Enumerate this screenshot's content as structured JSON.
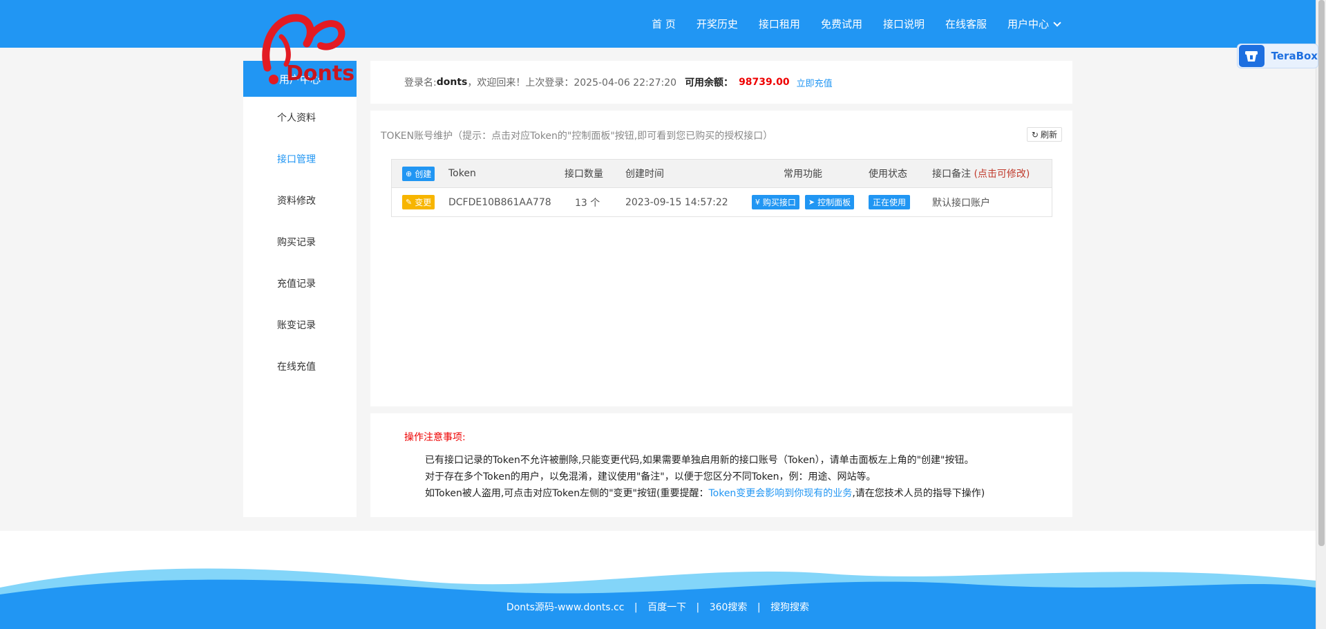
{
  "nav": {
    "items": [
      "首  页",
      "开奖历史",
      "接口租用",
      "免费试用",
      "接口说明",
      "在线客服",
      "用户中心"
    ]
  },
  "logo": {
    "text": "Donts"
  },
  "terabox": {
    "label": "TeraBox"
  },
  "sidebar": {
    "header": "用户中心",
    "items": [
      "个人资料",
      "接口管理",
      "资料修改",
      "购买记录",
      "充值记录",
      "账变记录",
      "在线充值"
    ],
    "active_index": 1
  },
  "welcome": {
    "login_label": "登录名:",
    "username": "donts",
    "welcome_text": "，欢迎回来！上次登录：2025-04-06 22:27:20",
    "balance_label": "可用余额：",
    "balance": "98739.00",
    "recharge": "立即充值"
  },
  "tokens": {
    "title": "TOKEN账号维护（提示：点击对应Token的\"控制面板\"按钮,即可看到您已购买的授权接口）",
    "refresh": "刷新",
    "create": "创建",
    "headers": [
      "Token",
      "接口数量",
      "创建时间",
      "常用功能",
      "使用状态",
      "接口备注"
    ],
    "note_hint": "(点击可修改)",
    "rows": [
      {
        "action": "变更",
        "token": "DCFDE10B861AA778",
        "count": "13 个",
        "created": "2023-09-15 14:57:22",
        "buy": "购买接口",
        "panel": "控制面板",
        "status": "正在使用",
        "remark": "默认接口账户"
      }
    ]
  },
  "notes": {
    "title": "操作注意事项:",
    "line1": "已有接口记录的Token不允许被删除,只能变更代码,如果需要单独启用新的接口账号（Token），请单击面板左上角的\"创建\"按钮。",
    "line2": "对于存在多个Token的用户，以免混淆，建议使用\"备注\"，以便于您区分不同Token，例：用途、网站等。",
    "line3_a": "如Token被人盗用,可点击对应Token左侧的\"变更\"按钮(重要提醒：",
    "line3_link": "Token变更会影响到你现有的业务",
    "line3_b": ",请在您技术人员的指导下操作)"
  },
  "footer": {
    "links": [
      "Donts源码-www.donts.cc",
      "百度一下",
      "360搜索",
      "搜狗搜索"
    ]
  },
  "colors": {
    "primary": "#2196f3",
    "danger": "#ee0000",
    "warning": "#f7b500"
  }
}
